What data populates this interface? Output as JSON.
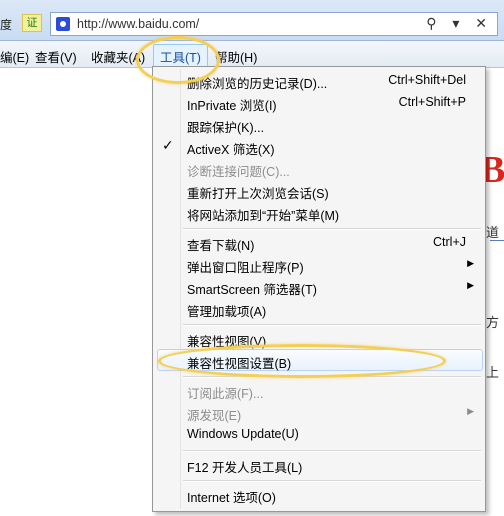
{
  "addressbar": {
    "site_label": "度",
    "cert_label": "证",
    "url": "http://www.baidu.com/",
    "icons": "⚲ ▾ ✕"
  },
  "menubar": {
    "edit": "编(E)",
    "view": "查看(V)",
    "favorites": "收藏夹(A)",
    "tools": "工具(T)",
    "help": "帮助(H)"
  },
  "page": {
    "logo_fragment": "Ba",
    "edge_text_1": "道",
    "edge_text_2": "方",
    "edge_text_3": "上"
  },
  "tools_menu": {
    "items": [
      {
        "label": "删除浏览的历史记录(D)...",
        "shortcut": "Ctrl+Shift+Del"
      },
      {
        "label": "InPrivate 浏览(I)",
        "shortcut": "Ctrl+Shift+P"
      },
      {
        "label": "跟踪保护(K)...",
        "shortcut": ""
      },
      {
        "label": "ActiveX 筛选(X)",
        "shortcut": "",
        "checked": true
      },
      {
        "label": "诊断连接问题(C)...",
        "shortcut": "",
        "disabled": true
      },
      {
        "label": "重新打开上次浏览会话(S)",
        "shortcut": ""
      },
      {
        "label": "将网站添加到“开始”菜单(M)",
        "shortcut": ""
      },
      {
        "label": "查看下载(N)",
        "shortcut": "Ctrl+J"
      },
      {
        "label": "弹出窗口阻止程序(P)",
        "submenu": true
      },
      {
        "label": "SmartScreen 筛选器(T)",
        "submenu": true
      },
      {
        "label": "管理加载项(A)"
      },
      {
        "label": "兼容性视图(V)"
      },
      {
        "label": "兼容性视图设置(B)",
        "highlighted": true
      },
      {
        "label": "订阅此源(F)...",
        "disabled": true
      },
      {
        "label": "源发现(E)",
        "disabled": true,
        "submenu": true
      },
      {
        "label": "Windows Update(U)"
      },
      {
        "label": "F12 开发人员工具(L)"
      },
      {
        "label": "Internet 选项(O)"
      }
    ],
    "check_glyph": "✓",
    "arrow_glyph": "▶"
  },
  "colors": {
    "highlight_ellipse": "#f3cf58",
    "baidu_red": "#d9261c"
  }
}
